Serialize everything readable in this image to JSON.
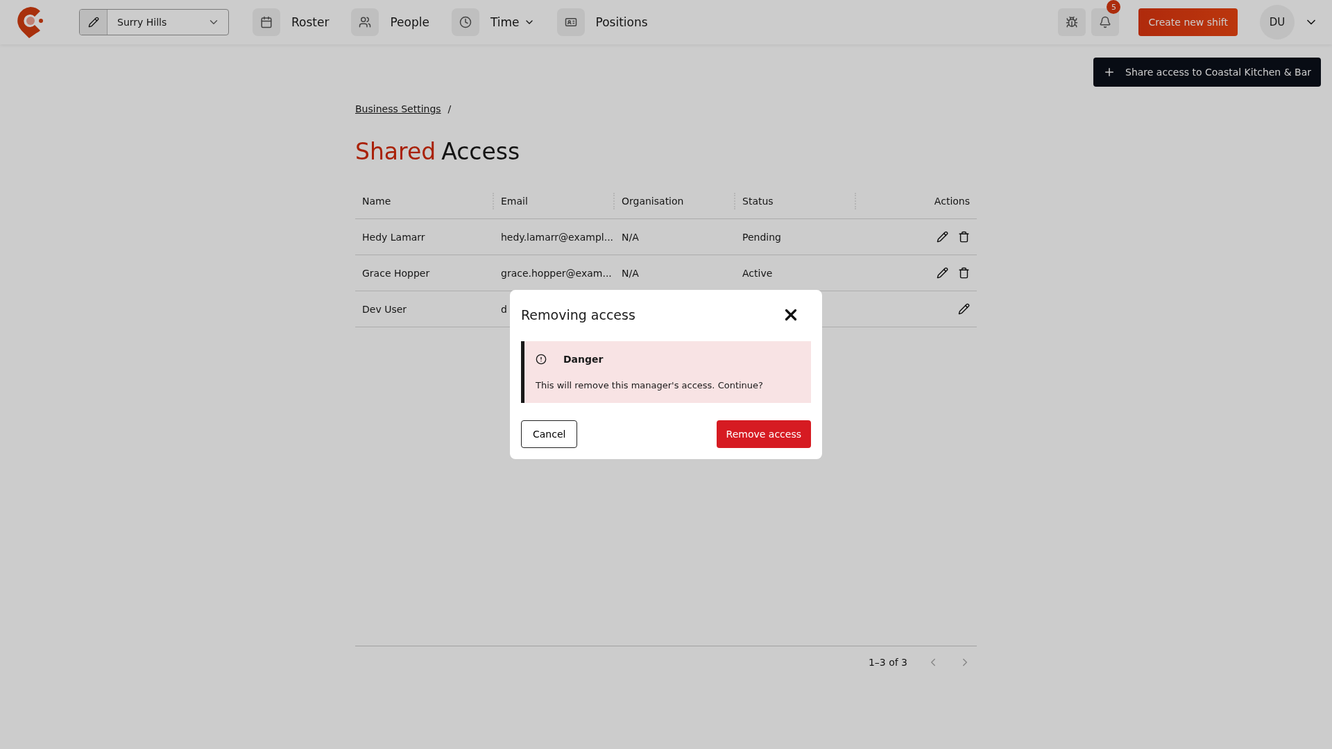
{
  "topbar": {
    "location": "Surry Hills",
    "nav": [
      {
        "label": "Roster",
        "has_menu": false
      },
      {
        "label": "People",
        "has_menu": false
      },
      {
        "label": "Time",
        "has_menu": true
      },
      {
        "label": "Positions",
        "has_menu": false
      }
    ],
    "notifications": "5",
    "create_button": "Create new shift",
    "avatar": "DU"
  },
  "share_button": "Share access to Coastal Kitchen & Bar",
  "breadcrumb": {
    "link": "Business Settings",
    "separator": "/"
  },
  "title": {
    "accent": "Shared",
    "rest": "Access"
  },
  "table": {
    "columns": [
      "Name",
      "Email",
      "Organisation",
      "Status",
      "Actions"
    ],
    "rows": [
      {
        "name": "Hedy Lamarr",
        "email": "hedy.lamarr@exampl...",
        "organisation": "N/A",
        "status": "Pending",
        "deletable": true
      },
      {
        "name": "Grace Hopper",
        "email": "grace.hopper@exam...",
        "organisation": "N/A",
        "status": "Active",
        "deletable": true
      },
      {
        "name": "Dev User",
        "email": "d",
        "deletable": false
      }
    ]
  },
  "pagination": {
    "range": "1–3 of 3"
  },
  "modal": {
    "title": "Removing access",
    "alert": {
      "title": "Danger",
      "message": "This will remove this manager's access. Continue?"
    },
    "cancel": "Cancel",
    "confirm": "Remove access"
  }
}
